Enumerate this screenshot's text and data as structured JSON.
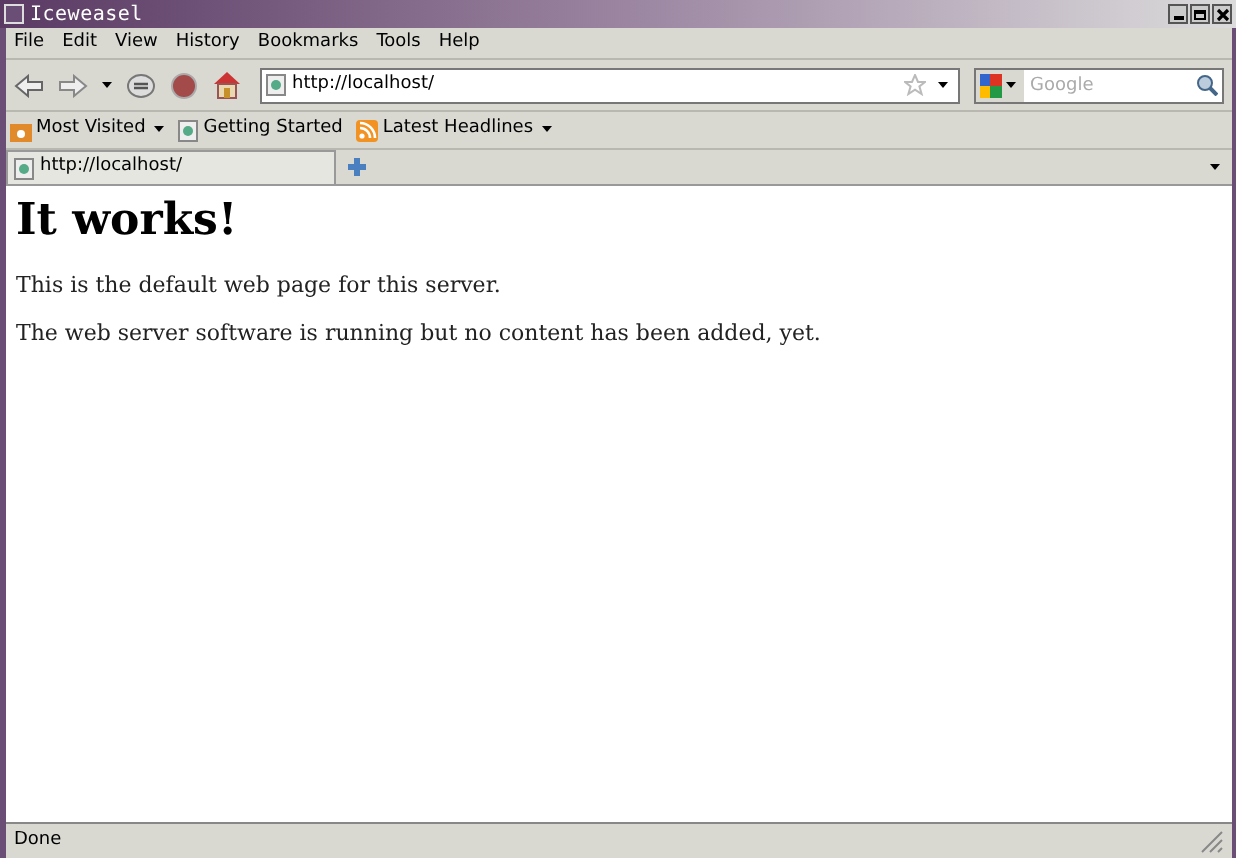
{
  "window": {
    "title": "Iceweasel"
  },
  "menu": [
    "File",
    "Edit",
    "View",
    "History",
    "Bookmarks",
    "Tools",
    "Help"
  ],
  "address_bar": {
    "value": "http://localhost/"
  },
  "search": {
    "placeholder": "Google"
  },
  "bookmarks": [
    {
      "label": "Most Visited",
      "kind": "folder"
    },
    {
      "label": "Getting Started",
      "kind": "page"
    },
    {
      "label": "Latest Headlines",
      "kind": "feed"
    }
  ],
  "tabs": [
    {
      "label": "http://localhost/",
      "selected": true
    }
  ],
  "page": {
    "heading": "It works!",
    "paragraphs": [
      "This is the default web page for this server.",
      "The web server software is running but no content has been added, yet."
    ]
  },
  "status_bar": {
    "text": "Done"
  }
}
